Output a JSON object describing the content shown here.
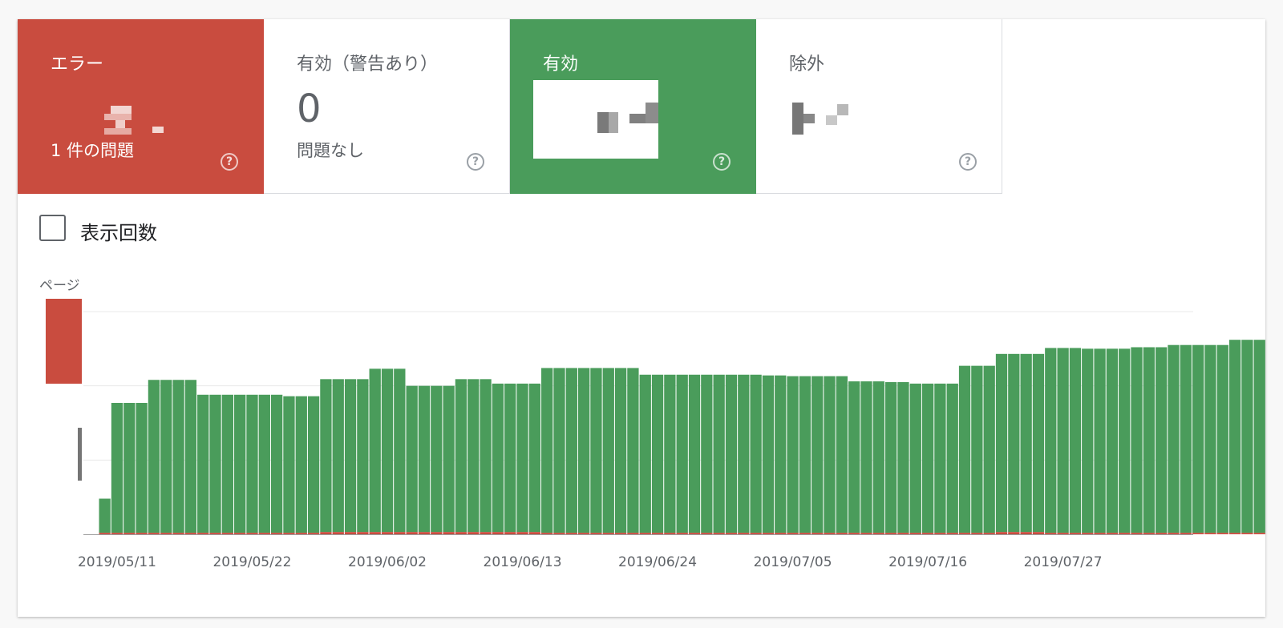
{
  "tiles": {
    "error": {
      "title": "エラー",
      "sub": "1 件の問題",
      "color": "#c94c3f"
    },
    "warning": {
      "title": "有効（警告あり）",
      "value": "0",
      "sub": "問題なし"
    },
    "valid": {
      "title": "有効",
      "color": "#4a9c5b"
    },
    "excluded": {
      "title": "除外"
    },
    "help_glyph": "?"
  },
  "impressions_toggle": {
    "label": "表示回数",
    "checked": false
  },
  "chart_data": {
    "type": "bar",
    "ylabel": "ページ",
    "grid": true,
    "series": [
      {
        "name": "有効",
        "color": "#4a9c5b",
        "values": [
          46,
          175,
          175,
          175,
          206,
          206,
          206,
          206,
          186,
          186,
          186,
          186,
          186,
          186,
          186,
          184,
          184,
          184,
          206,
          206,
          206,
          206,
          220,
          220,
          220,
          197,
          197,
          197,
          197,
          206,
          206,
          206,
          200,
          200,
          200,
          200,
          222,
          222,
          222,
          222,
          222,
          222,
          222,
          222,
          213,
          213,
          213,
          213,
          213,
          213,
          213,
          213,
          213,
          213,
          212,
          212,
          211,
          211,
          211,
          211,
          211,
          204,
          204,
          204,
          203,
          203,
          201,
          201,
          201,
          201,
          225,
          225,
          225,
          240,
          240,
          240,
          240,
          249,
          249,
          249,
          248,
          248,
          248,
          248,
          250,
          250,
          250,
          253,
          253,
          253,
          253,
          253,
          260,
          260,
          260
        ]
      },
      {
        "name": "エラー",
        "color": "#c94c3f",
        "values": [
          2,
          2,
          2,
          2,
          2,
          2,
          2,
          2,
          2,
          2,
          2,
          2,
          2,
          2,
          2,
          2,
          2,
          2,
          3,
          3,
          3,
          3,
          3,
          3,
          3,
          3,
          3,
          3,
          3,
          3,
          3,
          3,
          3,
          3,
          3,
          3,
          2,
          2,
          2,
          2,
          2,
          2,
          2,
          2,
          2,
          2,
          2,
          2,
          2,
          2,
          2,
          2,
          2,
          2,
          2,
          2,
          2,
          2,
          2,
          2,
          2,
          2,
          2,
          2,
          2,
          2,
          2,
          2,
          2,
          2,
          2,
          2,
          2,
          3,
          3,
          3,
          3,
          2,
          2,
          2,
          2,
          2,
          2,
          2,
          2,
          2,
          2,
          2,
          2,
          2,
          2,
          2,
          2,
          2,
          2
        ]
      }
    ],
    "start_date": "2019/05/10",
    "xtick_labels": [
      "2019/05/11",
      "2019/05/22",
      "2019/06/02",
      "2019/06/13",
      "2019/06/24",
      "2019/07/05",
      "2019/07/16",
      "2019/07/27"
    ],
    "ylim": [
      0,
      300
    ]
  }
}
